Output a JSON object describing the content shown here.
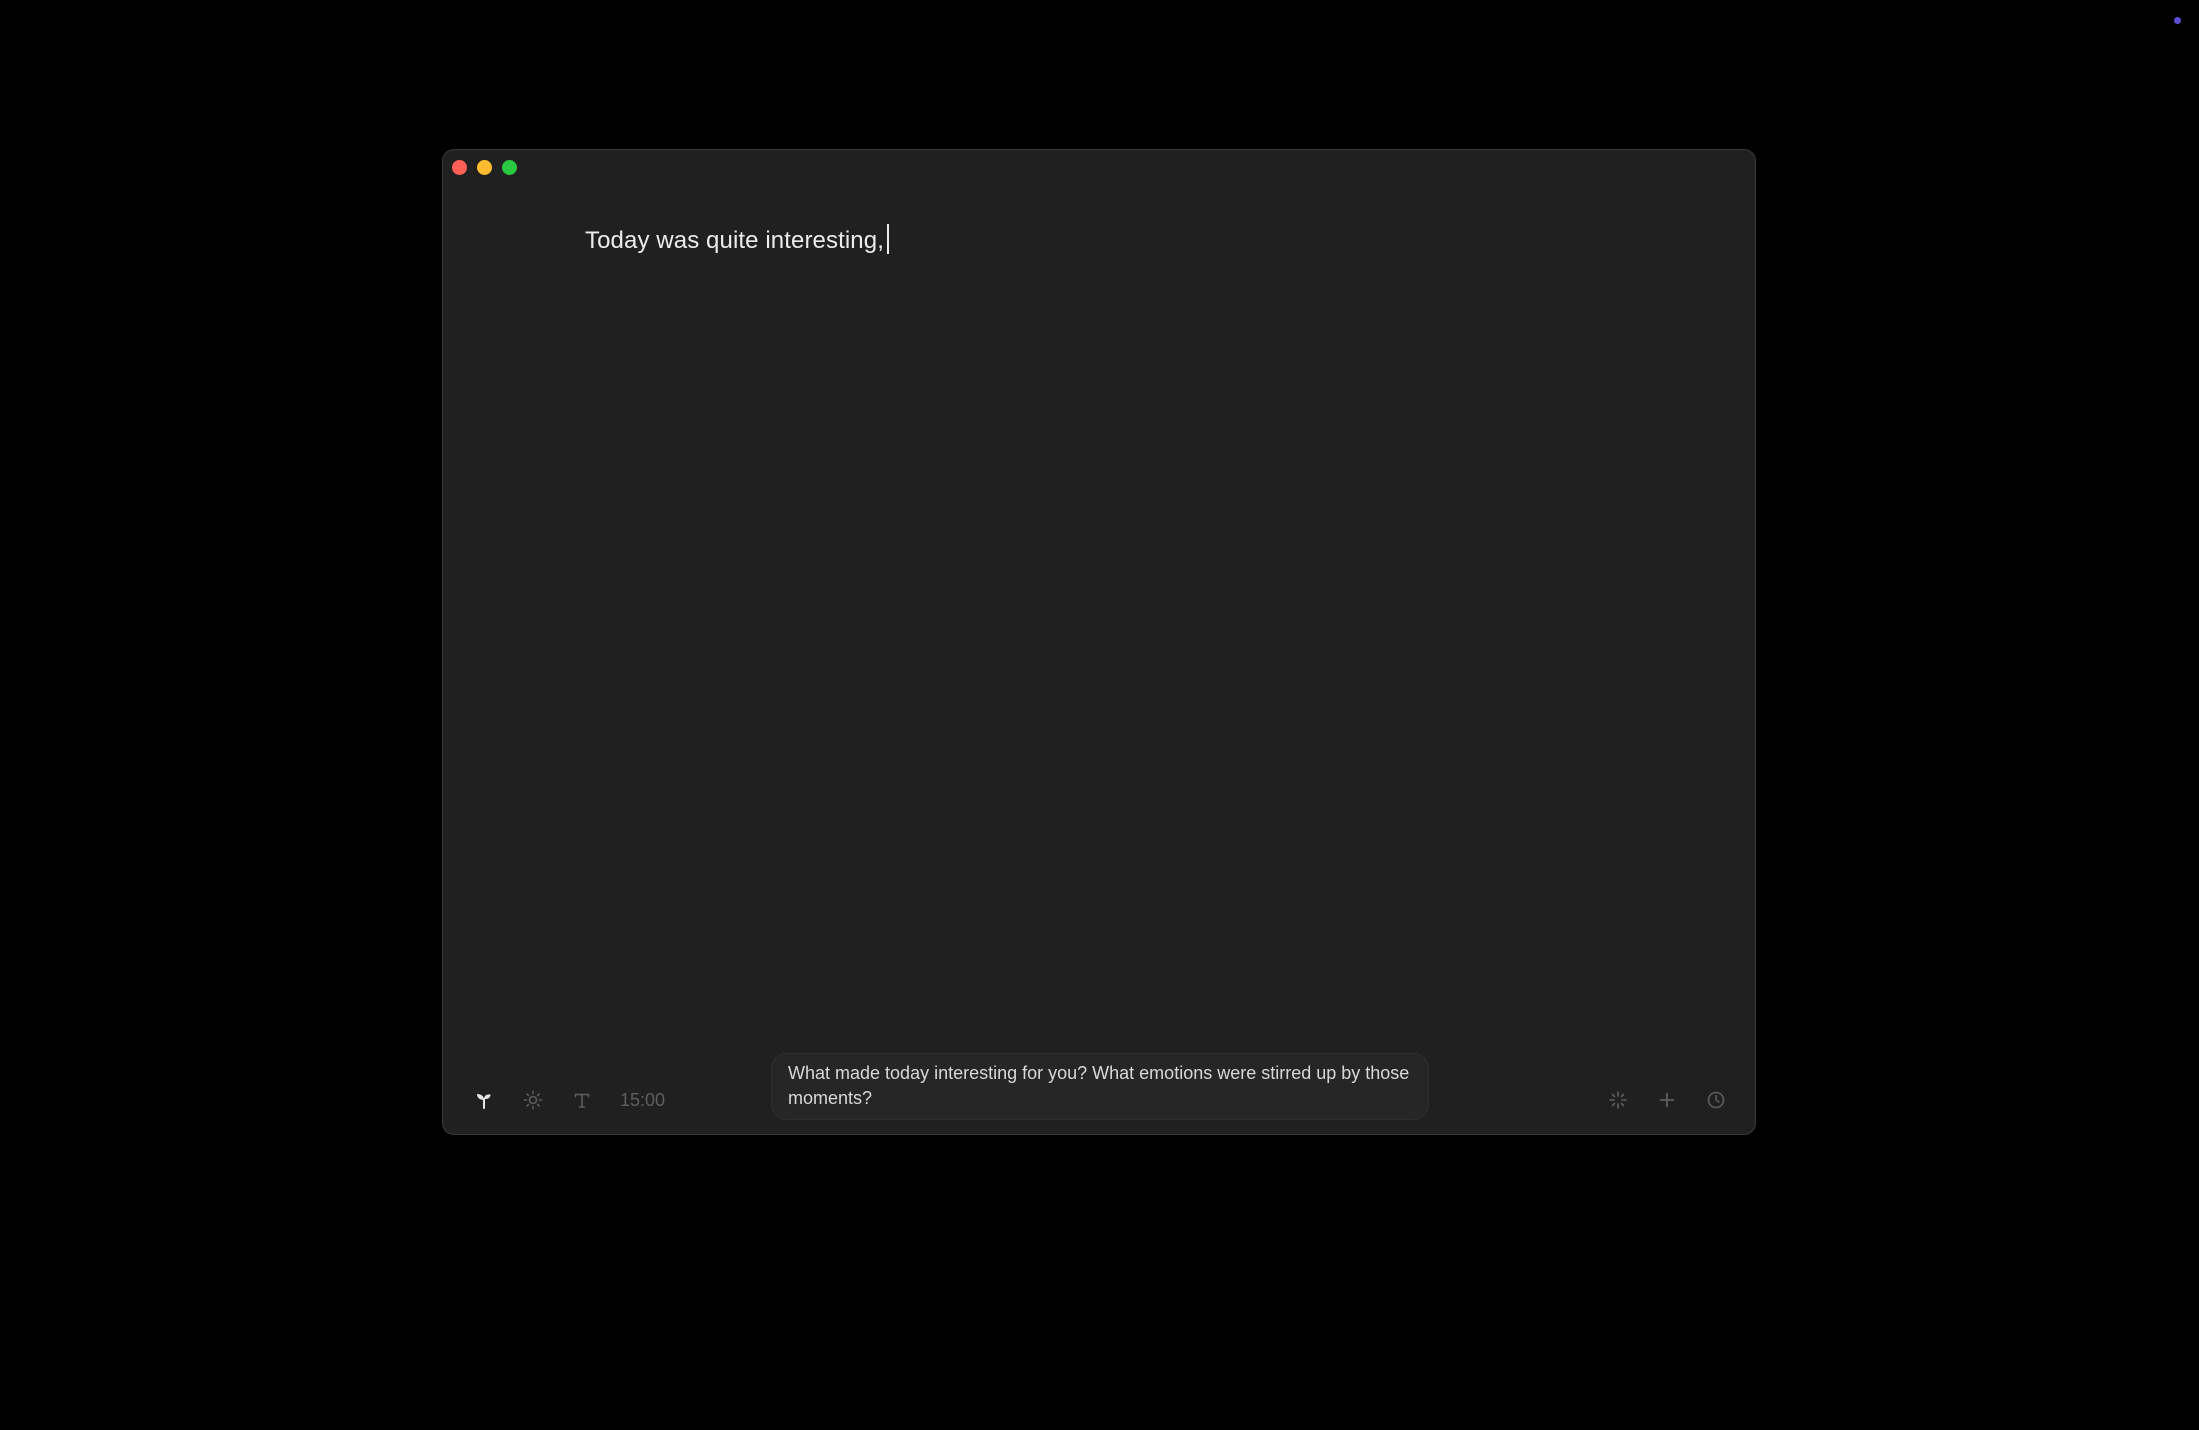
{
  "window": {
    "traffic_lights": {
      "close_color": "#fe5f57",
      "minimize_color": "#febc2e",
      "zoom_color": "#28c840"
    }
  },
  "editor": {
    "text": "Today was quite interesting,"
  },
  "toolbar": {
    "left": {
      "icons": [
        "sprout-icon",
        "sun-icon",
        "text-format-icon"
      ],
      "timer": "15:00"
    },
    "prompt_text": "What made today interesting for you? What emotions were stirred up by those moments?",
    "right": {
      "icons": [
        "sparkle-icon",
        "plus-icon",
        "clock-icon"
      ]
    }
  },
  "colors": {
    "background": "#000000",
    "window": "#202020",
    "text": "#ececec",
    "muted": "#5e5e5e",
    "accent_dot": "#5b4fd6"
  }
}
